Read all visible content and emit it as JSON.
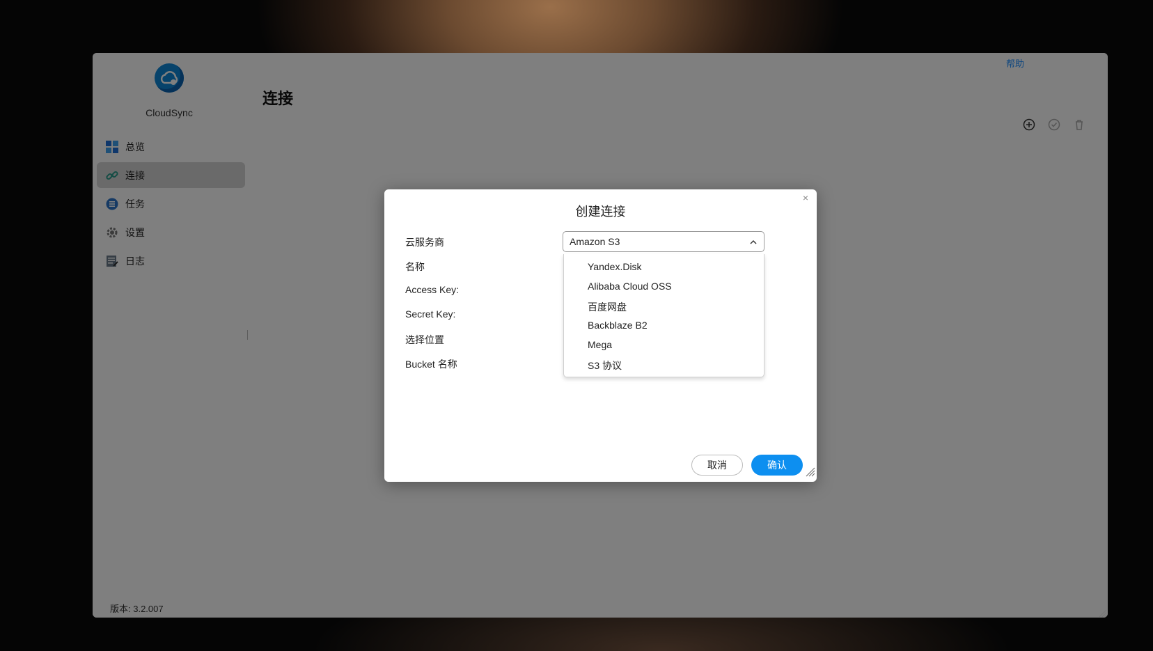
{
  "app": {
    "name": "CloudSync",
    "help_link": "帮助",
    "version": "版本: 3.2.007"
  },
  "sidebar": {
    "items": [
      {
        "label": "总览",
        "icon": "dashboard-icon"
      },
      {
        "label": "连接",
        "icon": "link-icon",
        "active": true
      },
      {
        "label": "任务",
        "icon": "task-list-icon"
      },
      {
        "label": "设置",
        "icon": "gear-icon"
      },
      {
        "label": "日志",
        "icon": "log-icon"
      }
    ]
  },
  "main": {
    "title": "连接",
    "toolbar": [
      "add-circle-icon",
      "check-circle-icon",
      "trash-icon"
    ]
  },
  "dialog": {
    "title": "创建连接",
    "close_glyph": "×",
    "labels": {
      "provider": "云服务商",
      "name": "名称",
      "access_key": "Access Key:",
      "secret_key": "Secret Key:",
      "location": "选择位置",
      "bucket": "Bucket 名称"
    },
    "provider_selected": "Amazon S3",
    "provider_options": [
      "Yandex.Disk",
      "Alibaba Cloud OSS",
      "百度网盘",
      "Backblaze B2",
      "Mega",
      "S3 协议"
    ],
    "cancel_label": "取消",
    "confirm_label": "确认"
  },
  "colors": {
    "accent": "#0d8ff0",
    "overlay": "rgba(0,0,0,0.5)",
    "sidebar_active": "#d4d4d4"
  }
}
